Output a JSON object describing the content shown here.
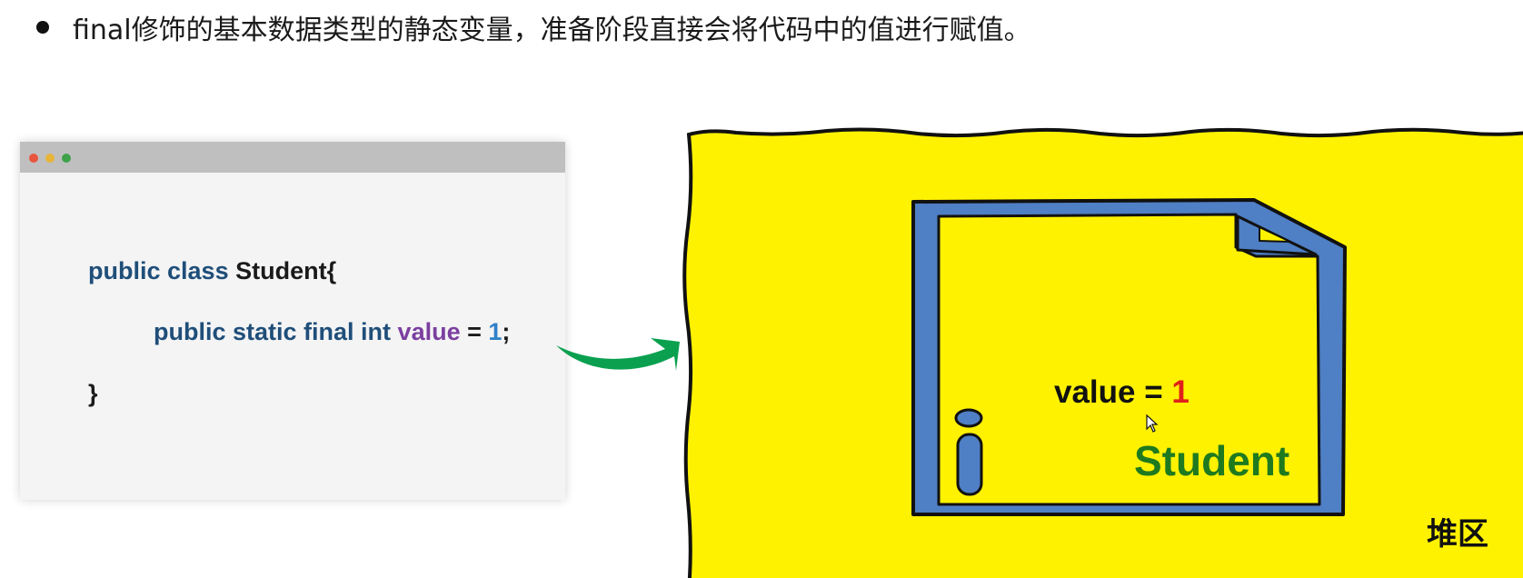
{
  "header": {
    "text": "final修饰的基本数据类型的静态变量，准备阶段直接会将代码中的值进行赋值。"
  },
  "code_window": {
    "line1": {
      "keyword": "public class ",
      "name": "Student{"
    },
    "line2": {
      "keyword": "public static final int ",
      "var": "value",
      "op": " = ",
      "num": "1",
      "end": ";"
    },
    "line3": {
      "text": "}"
    },
    "dot_colors": [
      "#e9553f",
      "#e8b53a",
      "#3fa14a"
    ]
  },
  "heap": {
    "label": "堆区",
    "fill_color": "#fff200",
    "object": {
      "field_text": "value = ",
      "field_value": "1",
      "class_name": "Student",
      "frame_color": "#4f7fc4"
    }
  },
  "colors": {
    "arrow": "#0aa050",
    "keyword": "#1f4e79",
    "variable": "#7b3fa0",
    "number": "#2f80c8",
    "value_red": "#e0201a",
    "class_green": "#1f7a1f"
  }
}
